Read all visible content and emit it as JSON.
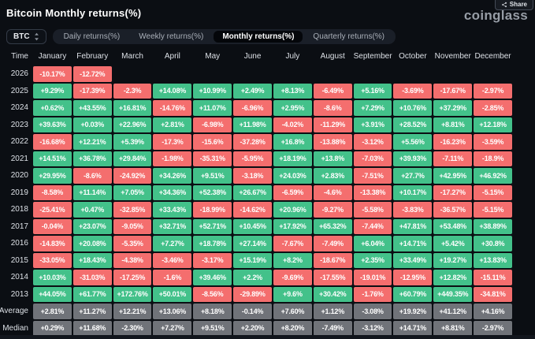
{
  "header": {
    "title": "Bitcoin Monthly returns(%)",
    "logo": "coinglass",
    "share_label": "Share"
  },
  "controls": {
    "coin_selector": "BTC",
    "tabs": [
      {
        "label": "Daily returns(%)",
        "active": false
      },
      {
        "label": "Weekly returns(%)",
        "active": false
      },
      {
        "label": "Monthly returns(%)",
        "active": true
      },
      {
        "label": "Quarterly returns(%)",
        "active": false
      }
    ]
  },
  "colors": {
    "background": "#0b0e13",
    "positive": "#43c18a",
    "negative": "#f46e6e",
    "neutral": "#707379"
  },
  "table": {
    "time_header": "Time",
    "months": [
      "January",
      "February",
      "March",
      "April",
      "May",
      "June",
      "July",
      "August",
      "September",
      "October",
      "November",
      "December"
    ],
    "rows": [
      {
        "label": "2026",
        "type": "year",
        "values": [
          "-10.17%",
          "-12.72%",
          "",
          "",
          "",
          "",
          "",
          "",
          "",
          "",
          "",
          ""
        ]
      },
      {
        "label": "2025",
        "type": "year",
        "values": [
          "+9.29%",
          "-17.39%",
          "-2.3%",
          "+14.08%",
          "+10.99%",
          "+2.49%",
          "+8.13%",
          "-6.49%",
          "+5.16%",
          "-3.69%",
          "-17.67%",
          "-2.97%"
        ]
      },
      {
        "label": "2024",
        "type": "year",
        "values": [
          "+0.62%",
          "+43.55%",
          "+16.81%",
          "-14.76%",
          "+11.07%",
          "-6.96%",
          "+2.95%",
          "-8.6%",
          "+7.29%",
          "+10.76%",
          "+37.29%",
          "-2.85%"
        ]
      },
      {
        "label": "2023",
        "type": "year",
        "values": [
          "+39.63%",
          "+0.03%",
          "+22.96%",
          "+2.81%",
          "-6.98%",
          "+11.98%",
          "-4.02%",
          "-11.29%",
          "+3.91%",
          "+28.52%",
          "+8.81%",
          "+12.18%"
        ]
      },
      {
        "label": "2022",
        "type": "year",
        "values": [
          "-16.68%",
          "+12.21%",
          "+5.39%",
          "-17.3%",
          "-15.6%",
          "-37.28%",
          "+16.8%",
          "-13.88%",
          "-3.12%",
          "+5.56%",
          "-16.23%",
          "-3.59%"
        ]
      },
      {
        "label": "2021",
        "type": "year",
        "values": [
          "+14.51%",
          "+36.78%",
          "+29.84%",
          "-1.98%",
          "-35.31%",
          "-5.95%",
          "+18.19%",
          "+13.8%",
          "-7.03%",
          "+39.93%",
          "-7.11%",
          "-18.9%"
        ]
      },
      {
        "label": "2020",
        "type": "year",
        "values": [
          "+29.95%",
          "-8.6%",
          "-24.92%",
          "+34.26%",
          "+9.51%",
          "-3.18%",
          "+24.03%",
          "+2.83%",
          "-7.51%",
          "+27.7%",
          "+42.95%",
          "+46.92%"
        ]
      },
      {
        "label": "2019",
        "type": "year",
        "values": [
          "-8.58%",
          "+11.14%",
          "+7.05%",
          "+34.36%",
          "+52.38%",
          "+26.67%",
          "-6.59%",
          "-4.6%",
          "-13.38%",
          "+10.17%",
          "-17.27%",
          "-5.15%"
        ]
      },
      {
        "label": "2018",
        "type": "year",
        "values": [
          "-25.41%",
          "+0.47%",
          "-32.85%",
          "+33.43%",
          "-18.99%",
          "-14.62%",
          "+20.96%",
          "-9.27%",
          "-5.58%",
          "-3.83%",
          "-36.57%",
          "-5.15%"
        ]
      },
      {
        "label": "2017",
        "type": "year",
        "values": [
          "-0.04%",
          "+23.07%",
          "-9.05%",
          "+32.71%",
          "+52.71%",
          "+10.45%",
          "+17.92%",
          "+65.32%",
          "-7.44%",
          "+47.81%",
          "+53.48%",
          "+38.89%"
        ]
      },
      {
        "label": "2016",
        "type": "year",
        "values": [
          "-14.83%",
          "+20.08%",
          "-5.35%",
          "+7.27%",
          "+18.78%",
          "+27.14%",
          "-7.67%",
          "-7.49%",
          "+6.04%",
          "+14.71%",
          "+5.42%",
          "+30.8%"
        ]
      },
      {
        "label": "2015",
        "type": "year",
        "values": [
          "-33.05%",
          "+18.43%",
          "-4.38%",
          "-3.46%",
          "-3.17%",
          "+15.19%",
          "+8.2%",
          "-18.67%",
          "+2.35%",
          "+33.49%",
          "+19.27%",
          "+13.83%"
        ]
      },
      {
        "label": "2014",
        "type": "year",
        "values": [
          "+10.03%",
          "-31.03%",
          "-17.25%",
          "-1.6%",
          "+39.46%",
          "+2.2%",
          "-9.69%",
          "-17.55%",
          "-19.01%",
          "-12.95%",
          "+12.82%",
          "-15.11%"
        ]
      },
      {
        "label": "2013",
        "type": "year",
        "values": [
          "+44.05%",
          "+61.77%",
          "+172.76%",
          "+50.01%",
          "-8.56%",
          "-29.89%",
          "+9.6%",
          "+30.42%",
          "-1.76%",
          "+60.79%",
          "+449.35%",
          "-34.81%"
        ]
      },
      {
        "label": "Average",
        "type": "summary",
        "values": [
          "+2.81%",
          "+11.27%",
          "+12.21%",
          "+13.06%",
          "+8.18%",
          "-0.14%",
          "+7.60%",
          "+1.12%",
          "-3.08%",
          "+19.92%",
          "+41.12%",
          "+4.16%"
        ]
      },
      {
        "label": "Median",
        "type": "summary",
        "values": [
          "+0.29%",
          "+11.68%",
          "-2.30%",
          "+7.27%",
          "+9.51%",
          "+2.20%",
          "+8.20%",
          "-7.49%",
          "-3.12%",
          "+14.71%",
          "+8.81%",
          "-2.97%"
        ]
      }
    ]
  }
}
